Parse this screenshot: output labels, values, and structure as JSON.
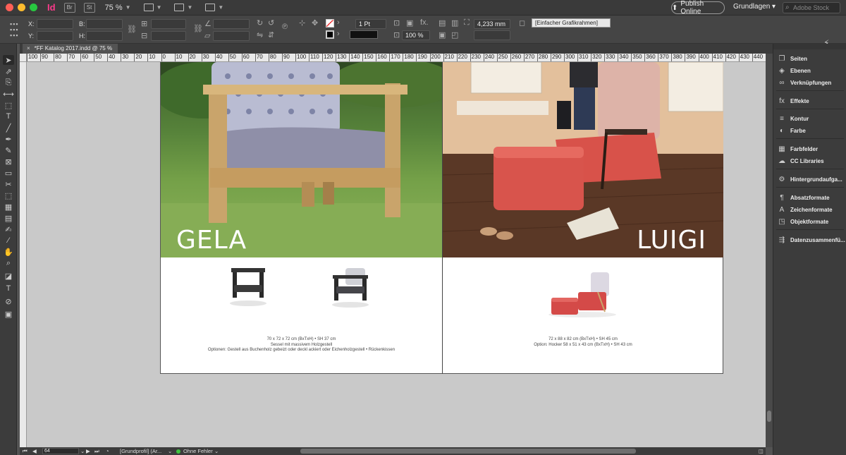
{
  "app": {
    "logo": "Id",
    "btn_bridge": "Br",
    "btn_stock": "St",
    "zoom": "75 %",
    "publish_label": "Publish Online",
    "workspace": "Grundlagen",
    "stock_search_placeholder": "Adobe Stock"
  },
  "control_bar": {
    "x_label": "X:",
    "y_label": "Y:",
    "w_label": "B:",
    "h_label": "H:",
    "stroke_weight": "1 Pt",
    "stroke_size": "4,233 mm",
    "scale": "100 %",
    "frame_style": "[Einfacher Grafikrahmen]"
  },
  "tab": {
    "title": "*FF Katalog 2017.indd @ 75 %",
    "close": "×"
  },
  "ruler": {
    "ticks": [
      "100",
      "90",
      "80",
      "70",
      "60",
      "50",
      "40",
      "30",
      "20",
      "10",
      "0",
      "10",
      "20",
      "30",
      "40",
      "50",
      "60",
      "70",
      "80",
      "90",
      "100",
      "110",
      "120",
      "130",
      "140",
      "150",
      "160",
      "170",
      "180",
      "190",
      "200",
      "210",
      "220",
      "230",
      "240",
      "250",
      "260",
      "270",
      "280",
      "290",
      "300",
      "310",
      "320",
      "330",
      "340",
      "350",
      "360",
      "370",
      "380",
      "390",
      "400",
      "410",
      "420",
      "430",
      "440"
    ]
  },
  "spread": {
    "left": {
      "title": "GELA",
      "spec_lines": [
        "70 x 72 x 72 cm (BxTxH)  •  SH 37 cm",
        "Sessel mit massivem Holzgestell",
        "Optionen: Gestell aus Buchenholz gebeizt oder deckl ackiert oder Eichenholzgestell  •  Rückenkissen"
      ]
    },
    "right": {
      "title": "LUIGI",
      "spec_lines": [
        "72 x 88 x 82 cm (BxTxH)  •  SH 45 cm",
        "Option: Hocker 58 x 51 x 43 cm (BxTxH)  •  SH 43 cm"
      ]
    }
  },
  "status": {
    "page": "64",
    "profile": "[Grundprofil] (Ar...",
    "errors": "Ohne Fehler"
  },
  "panels": [
    {
      "label": "Seiten",
      "icon": "pages-icon"
    },
    {
      "label": "Ebenen",
      "icon": "layers-icon"
    },
    {
      "label": "Verknüpfungen",
      "icon": "links-icon"
    },
    {
      "label": "Effekte",
      "icon": "effects-icon"
    },
    {
      "label": "Kontur",
      "icon": "stroke-icon"
    },
    {
      "label": "Farbe",
      "icon": "color-icon"
    },
    {
      "label": "Farbfelder",
      "icon": "swatches-icon"
    },
    {
      "label": "CC Libraries",
      "icon": "cc-libraries-icon"
    },
    {
      "label": "Hintergrundaufga...",
      "icon": "background-tasks-icon"
    },
    {
      "label": "Absatzformate",
      "icon": "paragraph-styles-icon"
    },
    {
      "label": "Zeichenformate",
      "icon": "character-styles-icon"
    },
    {
      "label": "Objektformate",
      "icon": "object-styles-icon"
    },
    {
      "label": "Datenzusammenfü...",
      "icon": "data-merge-icon"
    }
  ]
}
